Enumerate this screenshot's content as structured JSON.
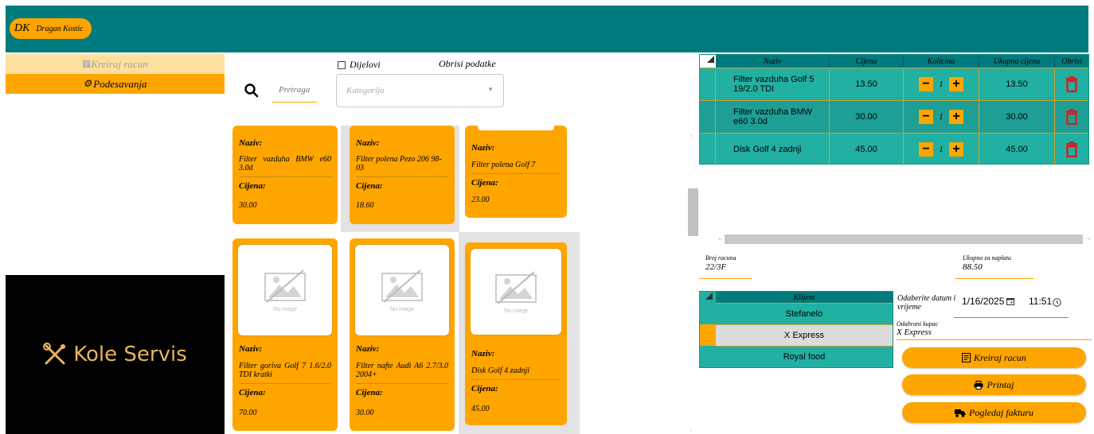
{
  "header": {
    "user_initials": "DK",
    "user_name": "Dragan Kostic"
  },
  "sidebar": {
    "items": [
      {
        "label": "Kreiraj racun",
        "icon": "receipt-icon"
      },
      {
        "label": "Podesavanja",
        "icon": "gear-icon"
      }
    ],
    "logo_text": "Kole Servis"
  },
  "search": {
    "label": "Pretraga",
    "category_placeholder": "Kategorija",
    "parts_checkbox_label": "Dijelovi",
    "clear_label": "Obrisi podatke"
  },
  "products": [
    {
      "name_label": "Naziv:",
      "name": "Filter vazduha BMW e60 3.0d",
      "price_label": "Cijena:",
      "price": "30.00"
    },
    {
      "name_label": "Naziv:",
      "name": "Filter polena Pezo 206 98-03",
      "price_label": "Cijena:",
      "price": "18.60"
    },
    {
      "name_label": "Naziv:",
      "name": "Filter polena Golf 7",
      "price_label": "Cijena:",
      "price": "23.00"
    },
    {
      "name_label": "Naziv:",
      "name": "Filter goriva Golf 7 1.6/2.0 TDI kratki",
      "price_label": "Cijena:",
      "price": "70.00",
      "image_caption": "No image"
    },
    {
      "name_label": "Naziv:",
      "name": "Filter nafte Audi A6 2.7/3.0 2004+",
      "price_label": "Cijena:",
      "price": "30.00",
      "image_caption": "No image"
    },
    {
      "name_label": "Naziv:",
      "name": "Disk Golf 4 zadnji",
      "price_label": "Cijena:",
      "price": "45.00",
      "image_caption": "No image"
    }
  ],
  "cart": {
    "columns": [
      "Naziv",
      "Cijena",
      "Kolicina",
      "Ukupna cijena",
      "Obrisi"
    ],
    "rows": [
      {
        "name": "Filter vazduha Golf 5 19/2.0 TDI",
        "price": "13.50",
        "qty": "1",
        "total": "13.50"
      },
      {
        "name": "Filter vazduha BMW e60 3.0d",
        "price": "30.00",
        "qty": "1",
        "total": "30.00"
      },
      {
        "name": "Disk Golf 4 zadnji",
        "price": "45.00",
        "qty": "1",
        "total": "45.00"
      }
    ]
  },
  "invoice": {
    "number_label": "Broj racuna",
    "number": "22/3F",
    "total_label": "Ukupno za naplatu",
    "total": "88.50",
    "date_label": "Odaberite datum i vrijeme",
    "date": "1/16/2025",
    "time": "11:51",
    "buyer_label": "Odabrani kupac",
    "buyer": "X Express"
  },
  "clients": {
    "header": "Klijent",
    "rows": [
      "Stefanelo",
      "X Express",
      "Royal food"
    ],
    "selected_index": 1
  },
  "actions": [
    {
      "label": "Kreiraj racun",
      "icon": "receipt-icon"
    },
    {
      "label": "Printaj",
      "icon": "printer-icon"
    },
    {
      "label": "Pogledaj fakturu",
      "icon": "truck-icon"
    }
  ],
  "colors": {
    "teal": "#007b7d",
    "row_teal": "#22b0a2",
    "orange": "#ffa500",
    "light_orange": "#ffdf9e",
    "delete_red": "#d32020"
  }
}
